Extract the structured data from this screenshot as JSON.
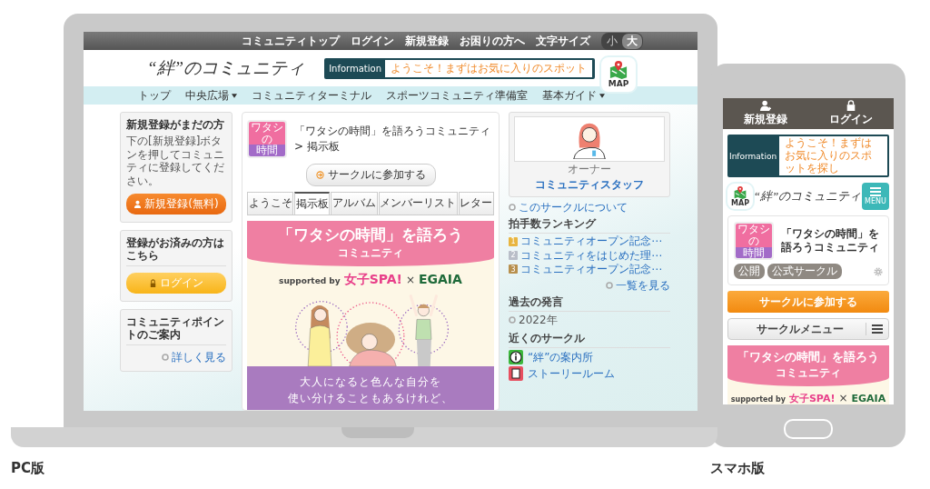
{
  "pc": {
    "caption": "PC版",
    "top_bar": {
      "links": [
        "コミュニティトップ",
        "ログイン",
        "新規登録",
        "お困りの方へ"
      ],
      "font_size": {
        "label": "文字サイズ",
        "options": [
          {
            "label": "小",
            "selected": false
          },
          {
            "label": "大",
            "selected": true
          }
        ]
      }
    },
    "header": {
      "logo": "“絆”のコミュニティ",
      "information": {
        "label": "Information",
        "text": "ようこそ！まずはお気に入りのスポット"
      },
      "map_button": "MAP"
    },
    "nav": [
      {
        "label": "トップ",
        "dropdown": false
      },
      {
        "label": "中央広場",
        "dropdown": true
      },
      {
        "label": "コミュニティターミナル",
        "dropdown": false
      },
      {
        "label": "スポーツコミュニティ準備室",
        "dropdown": false
      },
      {
        "label": "基本ガイド",
        "dropdown": true
      }
    ],
    "sidebar": {
      "signup": {
        "title": "新規登録がまだの方",
        "text": "下の[新規登録]ボタンを押してコミュニティに登録してください。",
        "button": "新規登録(無料)"
      },
      "login": {
        "title": "登録がお済みの方はこちら",
        "button": "ログイン"
      },
      "points": {
        "title": "コミュニティポイントのご案内",
        "link": "詳しく見る"
      }
    },
    "circle": {
      "badge": [
        "ワタシ",
        "の",
        "時間"
      ],
      "breadcrumb": "「ワタシの時間」を語ろうコミュニティ > 掲示板",
      "join_button": "サークルに参加する",
      "tabs": [
        {
          "label": "ようこそ",
          "selected": false
        },
        {
          "label": "掲示板",
          "selected": true
        },
        {
          "label": "アルバム",
          "selected": false
        },
        {
          "label": "メンバーリスト",
          "selected": false
        },
        {
          "label": "レター",
          "selected": false
        }
      ],
      "banner": {
        "title": "「ワタシの時間」を語ろう",
        "subtitle": "コミュニティ",
        "supported": "supported by",
        "brand_1": "女子SPA!",
        "times": "×",
        "brand_2": "EGAIA",
        "message": [
          "大人になると色んな自分を",
          "使い分けることもあるけれど、"
        ]
      }
    },
    "right_column": {
      "owner": {
        "role": "オーナー",
        "name": "コミュニティスタッフ"
      },
      "about_link": "このサークルについて",
      "ranking": {
        "title": "拍手数ランキング",
        "items": [
          {
            "rank": "1",
            "title": "コミュニティオープン記念⋯",
            "color": "#e8b540"
          },
          {
            "rank": "2",
            "title": "コミュニティをはじめた理⋯",
            "color": "#b9bec8"
          },
          {
            "rank": "3",
            "title": "コミュニティオープン記念⋯",
            "color": "#b8904e"
          }
        ],
        "more": "一覧を見る"
      },
      "past_posts": {
        "title": "過去の発言",
        "items": [
          "2022年"
        ]
      },
      "nearby": {
        "title": "近くのサークル",
        "items": [
          {
            "name": "“絆”の案内所",
            "kind": "info"
          },
          {
            "name": "ストーリールーム",
            "kind": "book"
          }
        ]
      }
    }
  },
  "sp": {
    "caption": "スマホ版",
    "top_buttons": [
      {
        "label": "新規登録",
        "kind": "signup"
      },
      {
        "label": "ログイン",
        "kind": "login"
      }
    ],
    "information": {
      "label": "Information",
      "text": "ようこそ！まずはお気に入りのスポットを探し"
    },
    "map_button": "MAP",
    "logo": "“絆”のコミュニティ",
    "menu_button": "MENU",
    "circle": {
      "badge": [
        "ワタシ",
        "の",
        "時間"
      ],
      "title": "「ワタシの時間」を語ろうコミュニティ",
      "tags": [
        "公開",
        "公式サークル"
      ],
      "join_button": "サークルに参加する",
      "menu_button": "サークルメニュー",
      "banner": {
        "title": "「ワタシの時間」を語ろう",
        "subtitle": "コミュニティ",
        "supported": "supported by",
        "brand_1": "女子SPA!",
        "times": "×",
        "brand_2": "EGAIA"
      }
    }
  }
}
